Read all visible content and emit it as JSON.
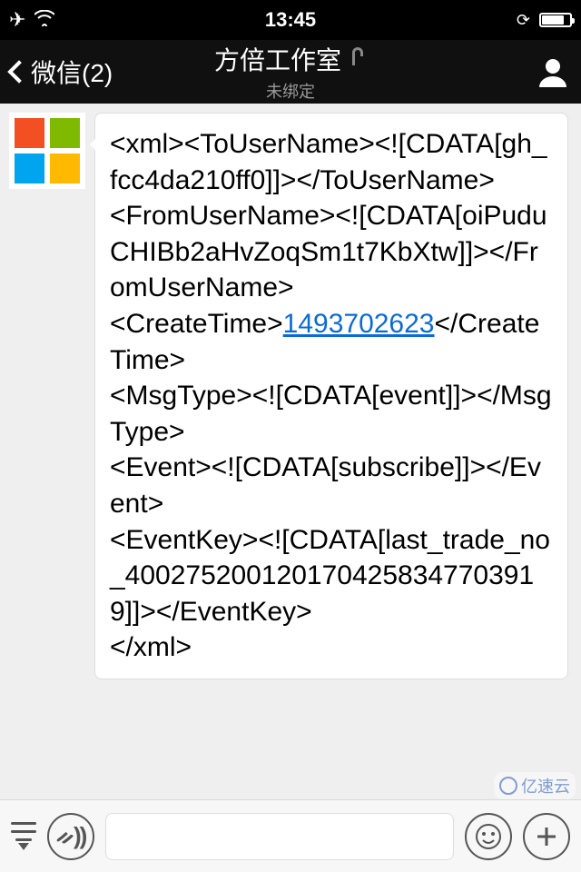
{
  "status": {
    "time": "13:45"
  },
  "nav": {
    "back_label": "微信(2)",
    "title": "方倍工作室",
    "subtitle": "未绑定"
  },
  "message": {
    "p1": "<xml><ToUserName><![CDATA[gh_fcc4da210ff0]]></ToUserName>",
    "p2": "<FromUserName><![CDATA[oiPuduCHIBb2aHvZoqSm1t7KbXtw]]></FromUserName>",
    "p3a": "<CreateTime>",
    "p3b": "1493702623",
    "p3c": "</CreateTime>",
    "p4": "<MsgType><![CDATA[event]]></MsgType>",
    "p5": "<Event><![CDATA[subscribe]]></Event>",
    "p6": "<EventKey><![CDATA[last_trade_no_4002752001201704258347703919]]></EventKey>",
    "p7": "</xml>"
  },
  "watermark": {
    "text": "亿速云"
  }
}
